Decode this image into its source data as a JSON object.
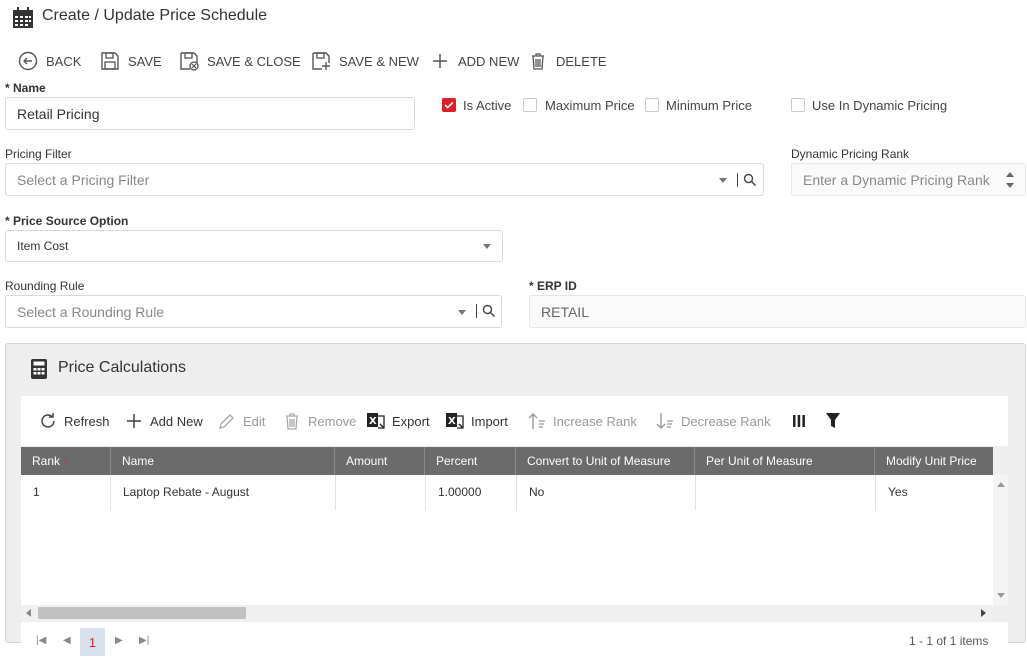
{
  "header": {
    "title": "Create / Update Price Schedule",
    "icon": "calendar-icon"
  },
  "toolbar": {
    "back": "BACK",
    "save": "SAVE",
    "save_close": "SAVE & CLOSE",
    "save_new": "SAVE & NEW",
    "add_new": "ADD NEW",
    "delete": "DELETE"
  },
  "form": {
    "name_label": "* Name",
    "name_value": "Retail Pricing",
    "is_active_label": "Is Active",
    "is_active_checked": true,
    "max_price_label": "Maximum Price",
    "max_price_checked": false,
    "min_price_label": "Minimum Price",
    "min_price_checked": false,
    "dynamic_label": "Use In Dynamic Pricing",
    "dynamic_checked": false,
    "pricing_filter_label": "Pricing Filter",
    "pricing_filter_placeholder": "Select a Pricing Filter",
    "dynamic_rank_label": "Dynamic Pricing Rank",
    "dynamic_rank_placeholder": "Enter a Dynamic Pricing Rank",
    "price_source_label": "* Price Source Option",
    "price_source_value": "Item Cost",
    "rounding_label": "Rounding Rule",
    "rounding_placeholder": "Select a Rounding Rule",
    "erp_label": "* ERP ID",
    "erp_value": "RETAIL"
  },
  "panel": {
    "title": "Price Calculations",
    "toolbar": {
      "refresh": "Refresh",
      "add_new": "Add New",
      "edit": "Edit",
      "remove": "Remove",
      "export": "Export",
      "import": "Import",
      "increase_rank": "Increase Rank",
      "decrease_rank": "Decrease Rank"
    },
    "columns": [
      "Rank",
      "Name",
      "Amount",
      "Percent",
      "Convert to Unit of Measure",
      "Per Unit of Measure",
      "Modify Unit Price"
    ],
    "rows": [
      [
        "1",
        "Laptop Rebate - August",
        "",
        "1.00000",
        "No",
        "",
        "Yes"
      ]
    ],
    "pager": {
      "current_page": "1",
      "info": "1 - 1 of 1 items"
    }
  },
  "colors": {
    "accent": "#e01e26",
    "grid_header": "#6b6b6b"
  }
}
